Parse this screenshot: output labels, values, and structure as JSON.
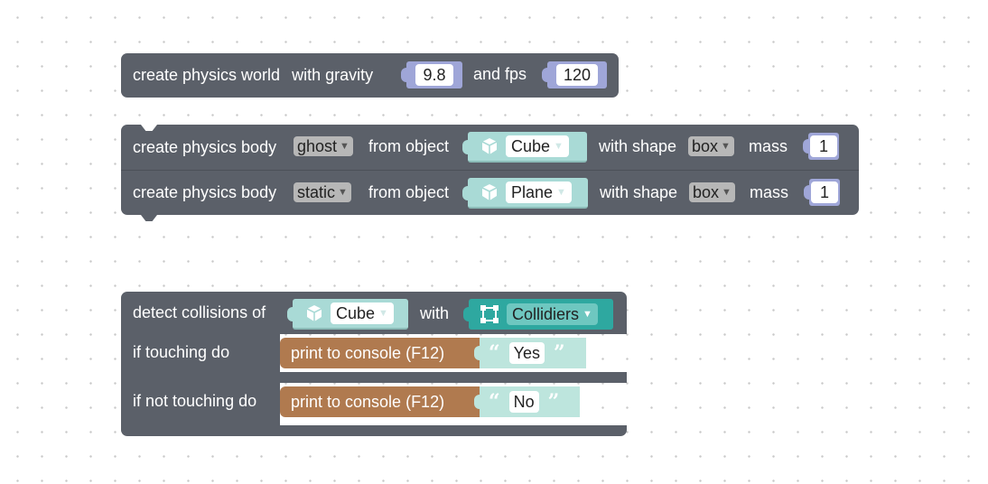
{
  "world": {
    "label": "create physics world",
    "gravity_label": "with gravity",
    "gravity": "9.8",
    "fps_label": "and fps",
    "fps": "120"
  },
  "bodies": [
    {
      "label": "create physics body",
      "mode": "ghost",
      "from_label": "from object",
      "object": "Cube",
      "shape_label": "with shape",
      "shape": "box",
      "mass_label": "mass",
      "mass": "1"
    },
    {
      "label": "create physics body",
      "mode": "static",
      "from_label": "from object",
      "object": "Plane",
      "shape_label": "with shape",
      "shape": "box",
      "mass_label": "mass",
      "mass": "1"
    }
  ],
  "collision": {
    "label": "detect collisions of",
    "object": "Cube",
    "with_label": "with",
    "target": "Collidiers",
    "touching_label": "if touching do",
    "not_touching_label": "if not touching do",
    "print_touching": {
      "label": "print to console (F12)",
      "text": "Yes"
    },
    "print_not_touching": {
      "label": "print to console (F12)",
      "text": "No"
    }
  },
  "colors": {
    "statement": "#5b6069",
    "number": "#9fa6d8",
    "object": "#a9dad6",
    "collider": "#2ea8a0",
    "print": "#b07a4f",
    "string": "#bde5dd"
  },
  "icons": {
    "object": "cube-icon",
    "collider": "bounding-box-icon",
    "dropdown": "triangle-down-icon",
    "quote_open": "open-quote-icon",
    "quote_close": "close-quote-icon"
  }
}
